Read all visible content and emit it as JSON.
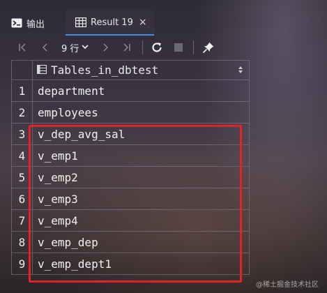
{
  "tabs": {
    "output_label": "输出",
    "result_label": "Result 19",
    "result_close": "×"
  },
  "toolbar": {
    "rows_value": "9 行"
  },
  "grid": {
    "column_header": "Tables_in_dbtest",
    "rows": [
      {
        "num": "1",
        "value": "department"
      },
      {
        "num": "2",
        "value": "employees"
      },
      {
        "num": "3",
        "value": "v_dep_avg_sal"
      },
      {
        "num": "4",
        "value": "v_emp1"
      },
      {
        "num": "5",
        "value": "v_emp2"
      },
      {
        "num": "6",
        "value": "v_emp3"
      },
      {
        "num": "7",
        "value": "v_emp4"
      },
      {
        "num": "8",
        "value": "v_emp_dep"
      },
      {
        "num": "9",
        "value": "v_emp_dept1"
      }
    ]
  },
  "highlight_color": "#e0232b",
  "accent_color": "#3f8fdc",
  "watermark": "@稀土掘金技术社区",
  "icons": [
    "console-icon",
    "table-icon",
    "first-page-icon",
    "prev-page-icon",
    "chevron-down-icon",
    "next-page-icon",
    "last-page-icon",
    "refresh-icon",
    "stop-icon",
    "pin-icon",
    "sort-icon"
  ]
}
